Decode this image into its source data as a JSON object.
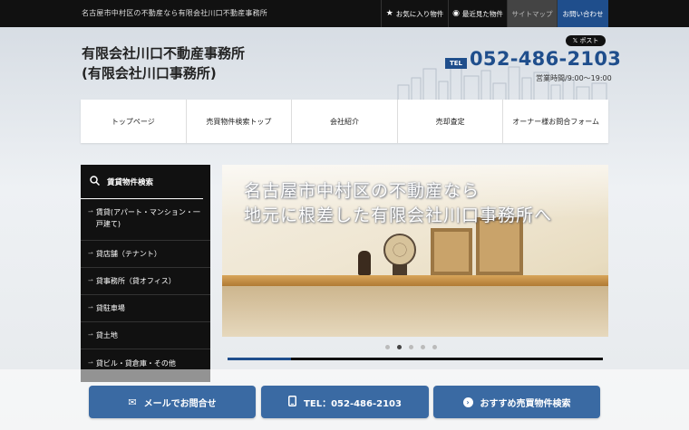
{
  "topbar": {
    "tagline": "名古屋市中村区の不動産なら有限会社川口不動産事務所",
    "nav": [
      {
        "label": "お気に入り物件",
        "icon": "star-icon"
      },
      {
        "label": "最近見た物件",
        "icon": "eye-icon"
      },
      {
        "label": "サイトマップ"
      },
      {
        "label": "お問い合わせ"
      }
    ]
  },
  "header": {
    "company_line1": "有限会社川口不動産事務所",
    "company_line2": "(有限会社川口事務所)",
    "x_post": "ポスト",
    "tel_tag": "TEL",
    "tel_number": "052-486-2103",
    "hours": "営業時間/9:00～19:00"
  },
  "gnav": [
    "トップページ",
    "売買物件検索トップ",
    "会社紹介",
    "売却査定",
    "オーナー様お問合フォーム"
  ],
  "sidebar": {
    "title": "賃貸物件検索",
    "items": [
      "賃貸(アパート・マンション・一戸建て)",
      "貸店舗（テナント）",
      "貸事務所（貸オフィス）",
      "貸駐車場",
      "貸土地",
      "貸ビル・貸倉庫・その他"
    ]
  },
  "slider": {
    "line1": "名古屋市中村区の不動産なら",
    "line2": "地元に根差した有限会社川口事務所へ",
    "dot_count": 5,
    "active_dot": 1,
    "progress": 0.17
  },
  "footer_buttons": [
    {
      "label": "メールでお問合せ",
      "icon": "mail-icon"
    },
    {
      "label": "TEL：052-486-2103",
      "icon": "phone-icon"
    },
    {
      "label": "おすすめ売買物件検索",
      "icon": "arrow-circle-icon"
    }
  ],
  "colors": {
    "accent": "#1f4e8c",
    "button": "#3a6aa3",
    "topbar": "#111111"
  }
}
